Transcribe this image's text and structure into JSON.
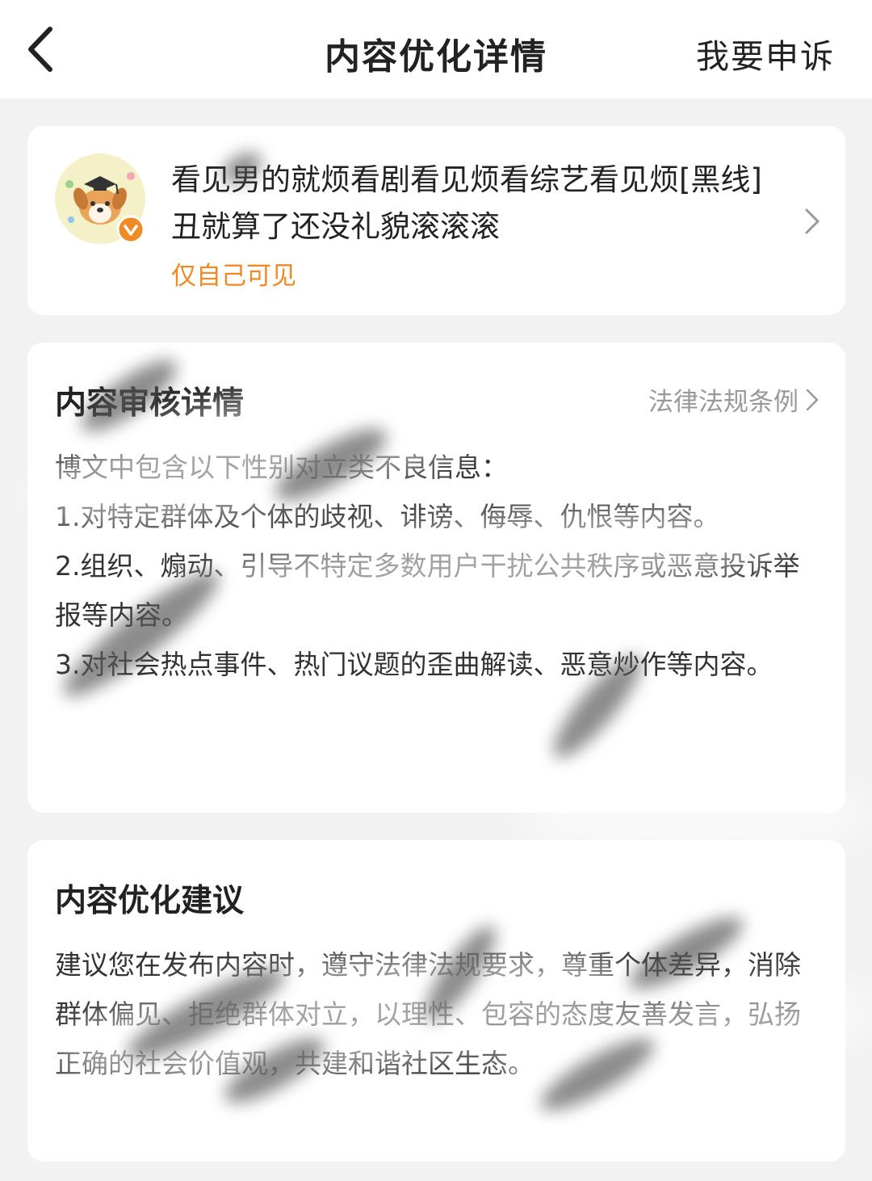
{
  "header": {
    "title": "内容优化详情",
    "appeal_label": "我要申诉"
  },
  "post": {
    "text": "看见男的就烦看剧看见烦看综艺看见烦[黑线]丑就算了还没礼貌滚滚滚",
    "visibility": "仅自己可见"
  },
  "review": {
    "title": "内容审核详情",
    "law_link": "法律法规条例",
    "intro": "博文中包含以下性别对立类不良信息：",
    "items": [
      "1.对特定群体及个体的歧视、诽谤、侮辱、仇恨等内容。",
      "2.组织、煽动、引导不特定多数用户干扰公共秩序或恶意投诉举报等内容。",
      "3.对社会热点事件、热门议题的歪曲解读、恶意炒作等内容。"
    ]
  },
  "suggestion": {
    "title": "内容优化建议",
    "text": "建议您在发布内容时，遵守法律法规要求，尊重个体差异，消除群体偏见、拒绝群体对立，以理性、包容的态度友善发言，弘扬正确的社会价值观，共建和谐社区生态。"
  },
  "colors": {
    "background": "#f2f2f2",
    "card": "#ffffff",
    "accent_orange": "#f08a24",
    "muted_text": "#999999"
  },
  "icons": {
    "back": "chevron-left-icon",
    "post_arrow": "chevron-right-icon",
    "law_arrow": "chevron-right-icon",
    "verified": "verified-badge-icon"
  }
}
